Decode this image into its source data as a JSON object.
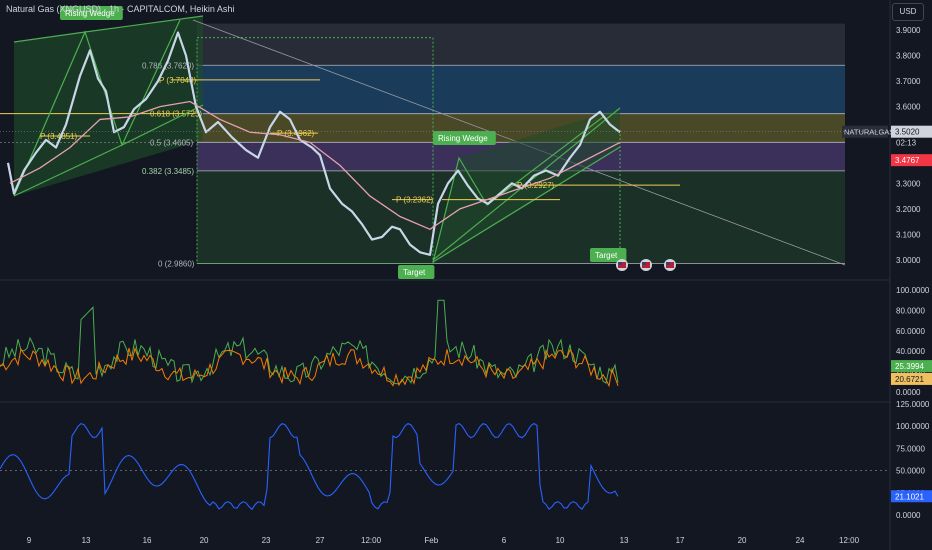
{
  "header": {
    "title": "Natural Gas (XNGUSD) · 1h · CAPITALCOM, Heikin Ashi",
    "currency_button": "USD"
  },
  "chart_data": {
    "type": "candlestick",
    "symbol": "NATURALGAS",
    "price_axis": [
      "3.9000",
      "3.8000",
      "3.7000",
      "3.6000",
      "3.5000",
      "3.4000",
      "3.3000",
      "3.2000",
      "3.1000",
      "3.0000"
    ],
    "last_price": "3.5020",
    "countdown": "02:13",
    "second_price_label": "3.4767",
    "x_axis": [
      "9",
      "13",
      "16",
      "20",
      "23",
      "27",
      "12:00",
      "Feb",
      "6",
      "10",
      "13",
      "17",
      "20",
      "24",
      "12:00"
    ],
    "fib_levels": [
      {
        "label": "0.786 (3.7620)",
        "price": 3.762
      },
      {
        "label": "0.618 (3.5725)",
        "price": 3.5725
      },
      {
        "label": "0.5 (3.4605)",
        "price": 3.4605
      },
      {
        "label": "0.382 (3.3485)",
        "price": 3.3485
      },
      {
        "label": "0 (2.9860)",
        "price": 2.986
      }
    ],
    "pivot_labels": [
      "P (3.4851)",
      "P (3.7048)",
      "P (3.4962)",
      "P (3.2362)",
      "P (3.2927)"
    ],
    "pattern_labels": [
      "Rising Wedge",
      "Rising Wedge"
    ],
    "target_labels": [
      "Target",
      "Target"
    ],
    "osc1_axis": [
      "100.0000",
      "80.0000",
      "60.0000",
      "40.0000",
      "20.0000",
      "0.0000"
    ],
    "osc1_green_value": "25.3994",
    "osc1_orange_value": "20.6721",
    "osc2_axis": [
      "125.0000",
      "100.0000",
      "75.0000",
      "50.0000",
      "25.0000",
      "0.0000"
    ],
    "osc2_value": "21.1021",
    "colors": {
      "bg": "#131722",
      "up": "#c7d7e8",
      "green": "#4caf50",
      "orange": "#f57c00",
      "blue": "#2962ff",
      "ma": "#e8a0b0",
      "yellow": "#f0d050"
    }
  }
}
